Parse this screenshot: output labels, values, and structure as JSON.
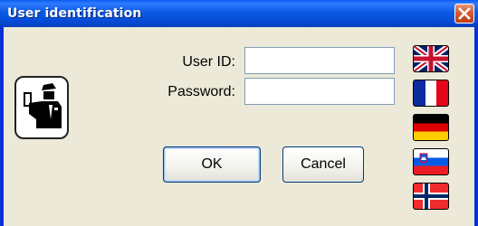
{
  "window": {
    "title": "User identification",
    "colors": {
      "titlebar": "#0054e3",
      "client": "#ece9d8",
      "close": "#d9582f"
    }
  },
  "icons": {
    "officer": "police-officer-icon",
    "close": "close-icon"
  },
  "form": {
    "user_id_label": "User ID:",
    "user_id_value": "",
    "password_label": "Password:",
    "password_value": ""
  },
  "buttons": {
    "ok": "OK",
    "cancel": "Cancel"
  },
  "languages": [
    {
      "icon": "uk-flag-icon"
    },
    {
      "icon": "france-flag-icon"
    },
    {
      "icon": "germany-flag-icon"
    },
    {
      "icon": "slovenia-flag-icon"
    },
    {
      "icon": "norway-flag-icon"
    }
  ]
}
